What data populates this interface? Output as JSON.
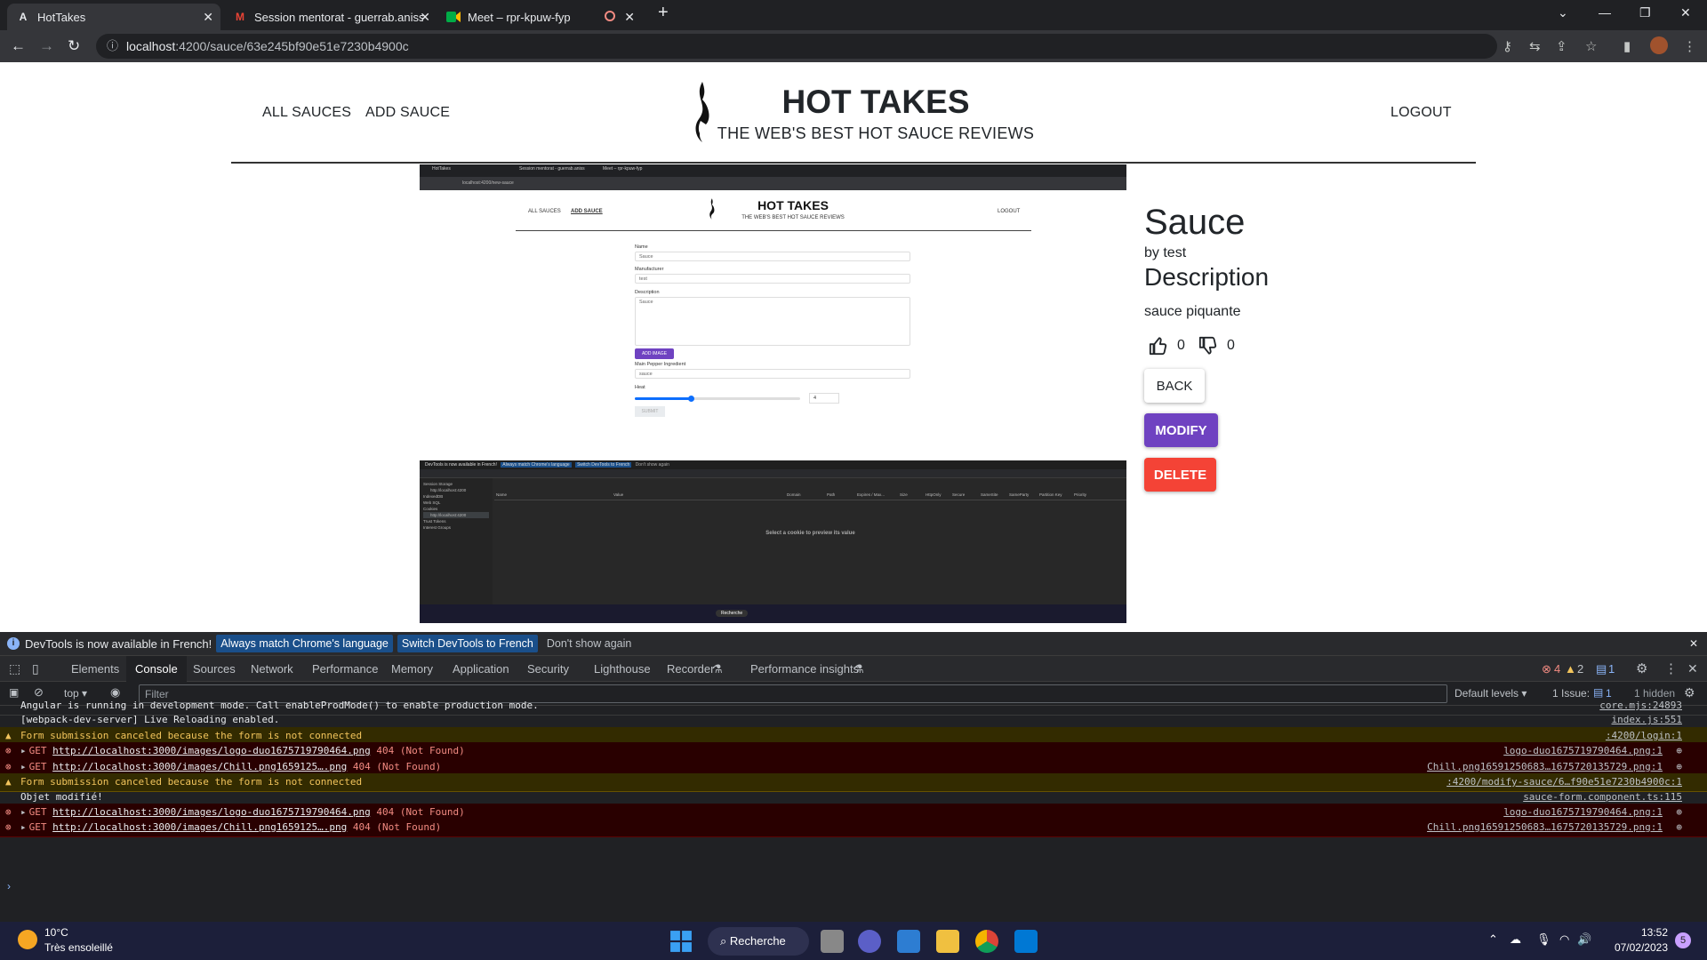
{
  "browser": {
    "tabs": [
      {
        "title": "HotTakes",
        "favicon": "A",
        "active": true
      },
      {
        "title": "Session mentorat - guerrab.aniss",
        "favicon": "M",
        "active": false
      },
      {
        "title": "Meet – rpr-kpuw-fyp",
        "favicon": "meet-icon",
        "active": false
      }
    ],
    "url_host": "localhost",
    "url_path": ":4200/sauce/63e245bf90e51e7230b4900c"
  },
  "header": {
    "nav_all": "ALL SAUCES",
    "nav_add": "ADD SAUCE",
    "title": "HOT TAKES",
    "subtitle": "THE WEB'S BEST HOT SAUCE REVIEWS",
    "logout": "LOGOUT"
  },
  "embedded": {
    "url": "localhost:4200/new-sauce",
    "tab1": "HotTakes",
    "tab2": "Session mentorat - guerrab.aniss",
    "tab3": "Meet – rpr-kpuw-fyp",
    "nav_all": "ALL SAUCES",
    "nav_add": "ADD SAUCE",
    "title": "HOT TAKES",
    "subtitle": "THE WEB'S BEST HOT SAUCE REVIEWS",
    "logout": "LOGOUT",
    "name_label": "Name",
    "name_value": "Sauce",
    "manufacturer_label": "Manufacturer",
    "manufacturer_value": "test",
    "description_label": "Description",
    "description_value": "Sauce",
    "add_image": "ADD IMAGE",
    "pepper_label": "Main Pepper Ingredient",
    "pepper_value": "sauce",
    "heat_label": "Heat",
    "heat_value": "4",
    "submit": "SUBMIT",
    "devtools_msg": "DevTools is now available in French!",
    "devtools_btn1": "Always match Chrome's language",
    "devtools_btn2": "Switch DevTools to French",
    "devtools_link": "Don't show again",
    "sidebar": [
      "Session Storage",
      "http://localhost:4200",
      "IndexedDB",
      "Web SQL",
      "Cookies",
      "http://localhost:4200",
      "Trust Tokens",
      "Interest Groups"
    ],
    "cols": [
      "Name",
      "Value",
      "Domain",
      "Path",
      "Expires / Max...",
      "Size",
      "HttpOnly",
      "Secure",
      "SameSite",
      "SameParty",
      "Partition Key",
      "Priority"
    ],
    "preview": "Select a cookie to preview its value",
    "search": "Recherche"
  },
  "sauce": {
    "name": "Sauce",
    "by": "by test",
    "description_heading": "Description",
    "description": "sauce piquante",
    "likes": "0",
    "dislikes": "0",
    "back": "BACK",
    "modify": "MODIFY",
    "delete": "DELETE"
  },
  "devtools": {
    "info_message": "DevTools is now available in French!",
    "btn_match": "Always match Chrome's language",
    "btn_switch": "Switch DevTools to French",
    "btn_dismiss": "Don't show again",
    "tabs": [
      "Elements",
      "Console",
      "Sources",
      "Network",
      "Performance",
      "Memory",
      "Application",
      "Security",
      "Lighthouse",
      "Recorder",
      "Performance insights"
    ],
    "errors_count": "4",
    "warnings_count": "2",
    "messages_count": "1",
    "context": "top",
    "filter_placeholder": "Filter",
    "levels": "Default levels",
    "issues": "1 Issue:",
    "issues_count": "1",
    "hidden": "1 hidden",
    "logs": [
      {
        "level": "info",
        "text": "Angular is running in development mode. Call enableProdMode() to enable production mode.",
        "source": "core.mjs:24893"
      },
      {
        "level": "info",
        "text": "[webpack-dev-server] Live Reloading enabled.",
        "source": "index.js:551"
      },
      {
        "level": "warn",
        "text": "Form submission canceled because the form is not connected",
        "source": ":4200/login:1"
      },
      {
        "level": "error",
        "prefix": "GET ",
        "url": "http://localhost:3000/images/logo-duo1675719790464.png",
        "status": " 404 (Not Found)",
        "source": "logo-duo1675719790464.png:1"
      },
      {
        "level": "error",
        "prefix": "GET ",
        "url": "http://localhost:3000/images/Chill.png1659125….png",
        "status": " 404 (Not Found)",
        "source": "Chill.png16591250683…1675720135729.png:1"
      },
      {
        "level": "warn",
        "text": "Form submission canceled because the form is not connected",
        "source": ":4200/modify-sauce/6…f90e51e7230b4900c:1"
      },
      {
        "level": "info",
        "text": "Objet modifié!",
        "source": "sauce-form.component.ts:115"
      },
      {
        "level": "error",
        "prefix": "GET ",
        "url": "http://localhost:3000/images/logo-duo1675719790464.png",
        "status": " 404 (Not Found)",
        "source": "logo-duo1675719790464.png:1"
      },
      {
        "level": "error",
        "prefix": "GET ",
        "url": "http://localhost:3000/images/Chill.png1659125….png",
        "status": " 404 (Not Found)",
        "source": "Chill.png16591250683…1675720135729.png:1"
      }
    ]
  },
  "taskbar": {
    "temperature": "10°C",
    "weather": "Très ensoleillé",
    "search": "Recherche",
    "time": "13:52",
    "date": "07/02/2023"
  },
  "colors": {
    "modify": "#6f42c1",
    "delete": "#f44336"
  }
}
